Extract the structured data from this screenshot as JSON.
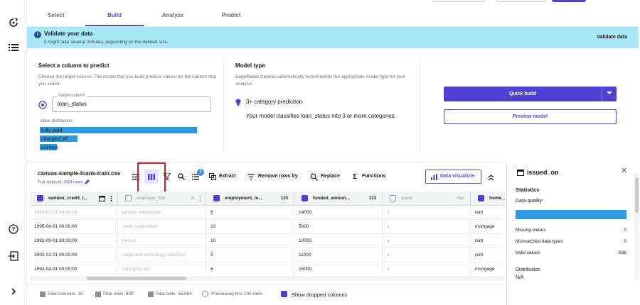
{
  "tabs": [
    {
      "label": "Select"
    },
    {
      "label": "Build"
    },
    {
      "label": "Analyze"
    },
    {
      "label": "Predict"
    }
  ],
  "banner": {
    "title": "Validate your data",
    "subtitle": "It might take several minutes, depending on the dataset size.",
    "action": "Validate data"
  },
  "target": {
    "title": "Select a column to predict",
    "desc": "Choose the target column. The model that you build predicts values for the column that you select.",
    "field_label": "Target column",
    "value": "loan_status",
    "dist_label": "Value distribution",
    "values": [
      {
        "label": "fully paid",
        "fraction": 1.0
      },
      {
        "label": "charged off",
        "fraction": 0.24
      },
      {
        "label": "current",
        "fraction": 0.11
      }
    ]
  },
  "model": {
    "title": "Model type",
    "desc": "SageMaker Canvas automatically recommends the appropriate model type for your analysis.",
    "type": "3+ category prediction",
    "type_desc": "Your model classifies loan_status into 3 or more categories."
  },
  "actions": {
    "quick_build": "Quick build",
    "preview": "Preview model"
  },
  "dataset": {
    "name": "canvas-sample-loans-train.csv",
    "full_label": "Full dataset:",
    "rows_label": "838 rows",
    "badge": "7",
    "extract": "Extract",
    "remove_rows": "Remove rows by",
    "replace": "Replace",
    "functions": "Functions",
    "visualizer": "Data visualizer"
  },
  "grid": {
    "columns": [
      {
        "name": "earliest_credit_l...",
        "type": "",
        "on": true
      },
      {
        "name": "employer_title",
        "type": "A",
        "on": false
      },
      {
        "name": "employment_le...",
        "type": "123",
        "on": true
      },
      {
        "name": "funded_amoun...",
        "type": "123",
        "on": true
      },
      {
        "name": "grade",
        "type": "Abc",
        "on": false
      },
      {
        "name": "home_...",
        "type": "",
        "on": true
      }
    ],
    "rows": [
      [
        "1999-07-01 00:00:00",
        "gollens warehouse",
        "6",
        "14000",
        "b",
        "rent"
      ],
      [
        "1995-06-01 00:00:00",
        "steris corporation",
        "10",
        "5000",
        "a",
        "mortgage"
      ],
      [
        "1992-09-01 00:00:00",
        "helicoil",
        "10",
        "10000",
        "a",
        "rent"
      ],
      [
        "2002-01-01 00:00:00",
        "cognizant technology solutions",
        "5",
        "11000",
        "a",
        "rent"
      ],
      [
        "1992-04-01 00:00:00",
        "caterpillar inc.",
        "8",
        "15000",
        "a",
        "mortgage"
      ]
    ]
  },
  "footer": {
    "total_columns": "Total columns: 18",
    "total_rows": "Total rows: 838",
    "total_cells": "Total cells: 15,084",
    "preview": "Previewing first 100 rows",
    "show_dropped": "Show dropped columns"
  },
  "panel": {
    "title": "issued_on",
    "statistics": "Statistics",
    "quality": "Data quality",
    "quality_fraction": 1.0,
    "missing_label": "Missing values",
    "missing_value": "0",
    "mismatched_label": "Mismatched data types",
    "mismatched_value": "0",
    "valid_label": "Valid values",
    "valid_value": "838",
    "distribution": "Distribution",
    "na": "N/A"
  },
  "colors": {
    "accent": "#4f3fd2",
    "banner": "#a9e8f7",
    "bar": "#2d9ae0"
  }
}
